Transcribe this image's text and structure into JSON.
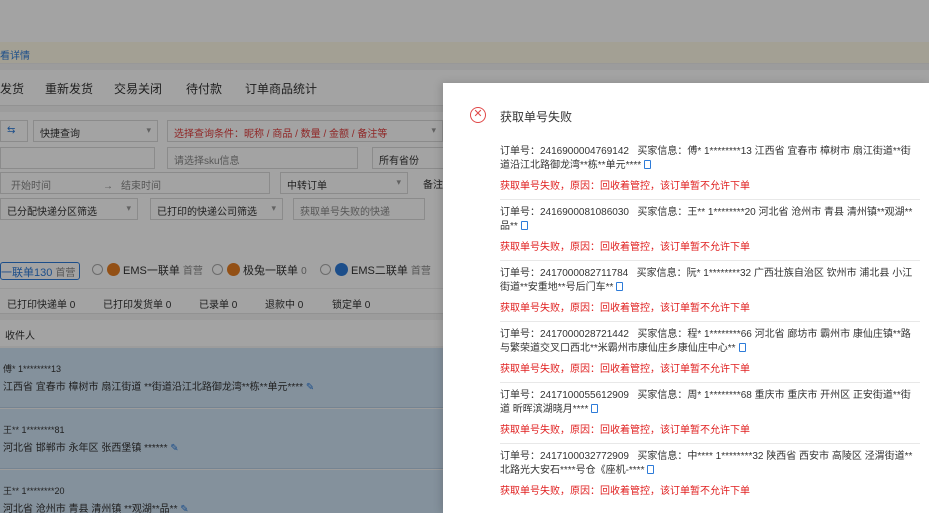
{
  "background": {
    "notice_link": "看详情",
    "tabs": [
      "发货",
      "重新发货",
      "交易关闭",
      "待付款",
      "订单商品统计"
    ],
    "filters": {
      "quick_query": "快捷查询",
      "condition_select": "选择查询条件：昵称 / 商品 / 数量 / 金额 / 备注等",
      "sku_placeholder": "请选择sku信息",
      "province": "所有省份",
      "start_time": "开始时间",
      "end_time": "结束时间",
      "order_type": "中转订单",
      "extra_label": "备注",
      "area_filter": "已分配快递分区筛选",
      "printed_filter": "已打印的快递公司筛选",
      "fail_query_placeholder": "获取单号失败的快递"
    },
    "channels": [
      {
        "name": "一联单130",
        "sub": "首营",
        "color": "#2d7bd8"
      },
      {
        "name": "EMS一联单",
        "sub": "首营",
        "color": "#e67e22"
      },
      {
        "name": "极兔一联单",
        "sub": "0",
        "color": "#e67e22"
      },
      {
        "name": "EMS二联单",
        "sub": "首营",
        "color": "#2d7bd8"
      }
    ],
    "subtabs": [
      {
        "label": "已打印快递单",
        "count": "0"
      },
      {
        "label": "已打印发货单",
        "count": "0"
      },
      {
        "label": "已录单",
        "count": "0"
      },
      {
        "label": "退款中",
        "count": "0"
      },
      {
        "label": "锁定单",
        "count": "0"
      }
    ],
    "column_receiver": "收件人",
    "rows": [
      {
        "line1": "傅* 1********13",
        "line2": "江西省 宜春市 樟树市 扇江街道 **街道沿江北路御龙湾**栋**单元****"
      },
      {
        "line1": "王** 1********81",
        "line2": "河北省 邯郸市 永年区 张西堡镇 ******"
      },
      {
        "line1": "王** 1********20",
        "line2": "河北省 沧州市 青县 清州镇 **观湖**品**"
      }
    ]
  },
  "dialog": {
    "title": "获取单号失败",
    "items": [
      {
        "order_no": "订单号：2416900004769142",
        "buyer": "买家信息：傅* 1********13 江西省 宜春市 樟树市 扇江街道**街道沿江北路御龙湾**栋**单元****",
        "reason": "获取单号失败，原因：回收着管控，该订单暂不允许下单"
      },
      {
        "order_no": "订单号：2416900081086030",
        "buyer": "买家信息：王** 1********20 河北省 沧州市 青县 清州镇**观湖**品**",
        "reason": "获取单号失败，原因：回收着管控，该订单暂不允许下单"
      },
      {
        "order_no": "订单号：2417000082711784",
        "buyer": "买家信息：阮* 1********32 广西壮族自治区 钦州市 浦北县 小江街道**安重地**号后门车**",
        "reason": "获取单号失败，原因：回收着管控，该订单暂不允许下单"
      },
      {
        "order_no": "订单号：2417000028721442",
        "buyer": "买家信息：程* 1********66 河北省 廊坊市 霸州市 康仙庄镇**路与繁荣道交叉口西北**米霸州市康仙庄乡康仙庄中心**",
        "reason": "获取单号失败，原因：回收着管控，该订单暂不允许下单"
      },
      {
        "order_no": "订单号：2417100055612909",
        "buyer": "买家信息：周* 1********68 重庆市 重庆市 开州区 正安街道**街道 昕晖滨湖晓月****",
        "reason": "获取单号失败，原因：回收着管控，该订单暂不允许下单"
      },
      {
        "order_no": "订单号：2417100032772909",
        "buyer": "买家信息：中**** 1********32 陕西省 西安市 高陵区 泾渭街道**北路光大安石****号仓《座机-****",
        "reason": "获取单号失败，原因：回收着管控，该订单暂不允许下单"
      }
    ]
  }
}
